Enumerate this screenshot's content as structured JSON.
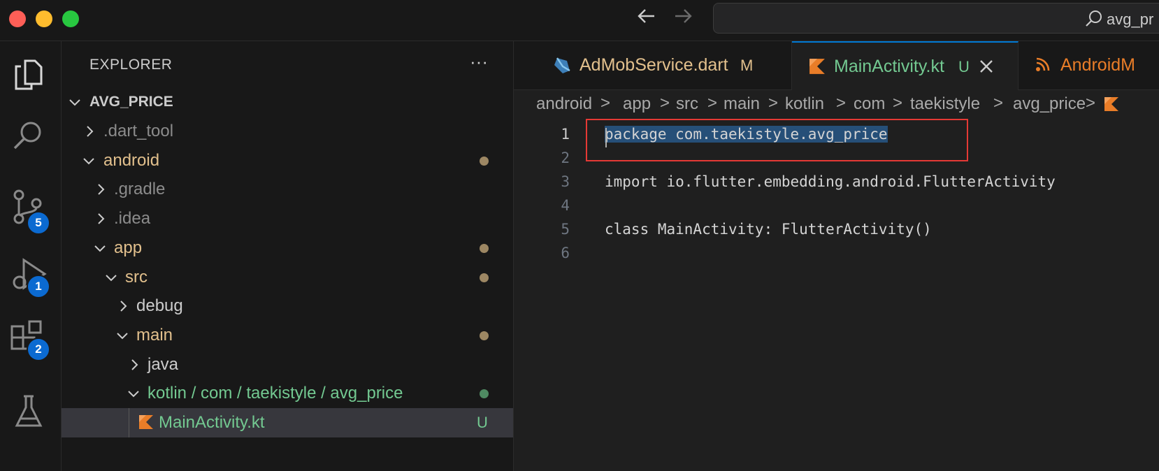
{
  "window": {
    "traffic_lights": {
      "close_color": "#ff5f57",
      "minimize_color": "#febc2e",
      "maximize_color": "#28c840"
    },
    "nav": {
      "back_icon": "arrow-left-icon",
      "forward_icon": "arrow-right-icon"
    },
    "command_center": {
      "icon": "search-icon",
      "text": "avg_pr"
    }
  },
  "activity_bar": {
    "items": [
      {
        "name": "explorer",
        "icon": "files-icon",
        "badge": ""
      },
      {
        "name": "search",
        "icon": "search-icon",
        "badge": ""
      },
      {
        "name": "source-control",
        "icon": "source-control-icon",
        "badge": "5"
      },
      {
        "name": "run-debug",
        "icon": "run-debug-icon",
        "badge": "1"
      },
      {
        "name": "extensions",
        "icon": "extensions-icon",
        "badge": "2"
      },
      {
        "name": "testing",
        "icon": "beaker-icon",
        "badge": ""
      }
    ]
  },
  "explorer": {
    "header": "EXPLORER",
    "more_icon": "ellipsis-icon",
    "root": "AVG_PRICE",
    "items": [
      {
        "label": ".dart_tool",
        "expanded": false,
        "color": "#8c8c8c",
        "status": ""
      },
      {
        "label": "android",
        "expanded": true,
        "color": "#e2c08d",
        "status": "dot"
      },
      {
        "label": ".gradle",
        "expanded": false,
        "color": "#8c8c8c",
        "status": ""
      },
      {
        "label": ".idea",
        "expanded": false,
        "color": "#8c8c8c",
        "status": ""
      },
      {
        "label": "app",
        "expanded": true,
        "color": "#e2c08d",
        "status": "dot"
      },
      {
        "label": "src",
        "expanded": true,
        "color": "#e2c08d",
        "status": "dot"
      },
      {
        "label": "debug",
        "expanded": false,
        "color": "#cccccc",
        "status": ""
      },
      {
        "label": "main",
        "expanded": true,
        "color": "#e2c08d",
        "status": "dot"
      },
      {
        "label": "java",
        "expanded": false,
        "color": "#cccccc",
        "status": ""
      },
      {
        "label": "kotlin / com / taekistyle / avg_price",
        "expanded": true,
        "color": "#73c991",
        "status": "dot"
      },
      {
        "label": "MainActivity.kt",
        "expanded": false,
        "color": "#73c991",
        "status": "U"
      }
    ]
  },
  "tabs": [
    {
      "label": "AdMobService.dart",
      "status": "M",
      "icon": "dart-icon",
      "active": false
    },
    {
      "label": "MainActivity.kt",
      "status": "U",
      "icon": "kotlin-icon",
      "active": true,
      "close_icon": "close-icon"
    },
    {
      "label": "AndroidM",
      "status": "",
      "icon": "rss-icon",
      "active": false
    }
  ],
  "breadcrumbs": [
    "android",
    "app",
    "src",
    "main",
    "kotlin",
    "com",
    "taekistyle",
    "avg_price"
  ],
  "breadcrumb_sep": ">",
  "editor": {
    "lines": [
      {
        "num": "1",
        "text": "package com.taekistyle.avg_price"
      },
      {
        "num": "2",
        "text": ""
      },
      {
        "num": "3",
        "text": "import io.flutter.embedding.android.FlutterActivity"
      },
      {
        "num": "4",
        "text": ""
      },
      {
        "num": "5",
        "text": "class MainActivity: FlutterActivity()"
      },
      {
        "num": "6",
        "text": ""
      }
    ]
  },
  "colors": {
    "accent": "#0078d4",
    "modified": "#e2c08d",
    "untracked": "#73c991",
    "kotlin": "#e97d28",
    "selection": "#264f78",
    "annotation": "#e53935"
  }
}
